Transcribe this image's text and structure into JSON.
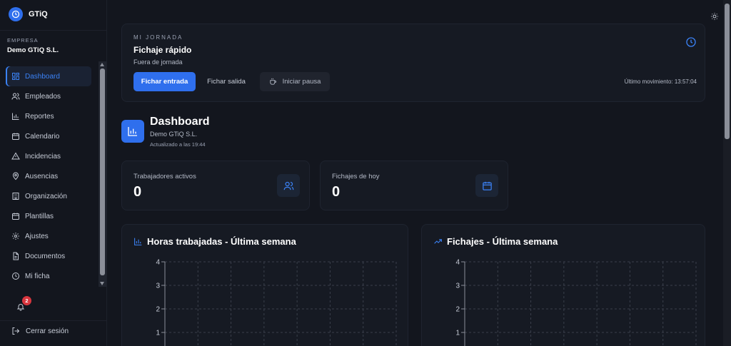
{
  "app": {
    "name": "GTiQ"
  },
  "company": {
    "label": "EMPRESA",
    "name": "Demo GTiQ S.L."
  },
  "nav": [
    {
      "label": "Dashboard",
      "icon": "dashboard-icon",
      "active": true
    },
    {
      "label": "Empleados",
      "icon": "users-icon"
    },
    {
      "label": "Reportes",
      "icon": "bar-chart-icon"
    },
    {
      "label": "Calendario",
      "icon": "calendar-icon"
    },
    {
      "label": "Incidencias",
      "icon": "warning-icon"
    },
    {
      "label": "Ausencias",
      "icon": "map-pin-icon"
    },
    {
      "label": "Organización",
      "icon": "building-icon"
    },
    {
      "label": "Plantillas",
      "icon": "calendar-template-icon"
    },
    {
      "label": "Ajustes",
      "icon": "gear-icon"
    },
    {
      "label": "Documentos",
      "icon": "document-icon"
    },
    {
      "label": "Mi ficha",
      "icon": "clock-icon"
    }
  ],
  "notifications": {
    "count": "2"
  },
  "logout": {
    "label": "Cerrar sesión"
  },
  "jornada": {
    "kicker": "MI JORNADA",
    "title": "Fichaje rápido",
    "status": "Fuera de jornada",
    "btn_in": "Fichar entrada",
    "btn_out": "Fichar salida",
    "btn_pause": "Iniciar pausa",
    "last_move": "Último movimiento: 13:57:04"
  },
  "dashboard": {
    "title": "Dashboard",
    "company": "Demo GTiQ S.L.",
    "updated": "Actualizado a las 19:44"
  },
  "stats": [
    {
      "label": "Trabajadores activos",
      "value": "0",
      "icon": "users-icon"
    },
    {
      "label": "Fichajes de hoy",
      "value": "0",
      "icon": "calendar-icon"
    }
  ],
  "charts": [
    {
      "title": "Horas trabajadas - Última semana",
      "icon": "bar-chart-icon"
    },
    {
      "title": "Fichajes - Última semana",
      "icon": "trending-up-icon"
    }
  ],
  "chart_data": [
    {
      "type": "bar",
      "title": "Horas trabajadas - Última semana",
      "yticks": [
        4,
        3,
        2,
        1
      ],
      "ylim": [
        0,
        4
      ],
      "grid": true,
      "series": []
    },
    {
      "type": "line",
      "title": "Fichajes - Última semana",
      "yticks": [
        4,
        3,
        2,
        1
      ],
      "ylim": [
        0,
        4
      ],
      "grid": true,
      "series": []
    }
  ],
  "colors": {
    "accent": "#2f6fed",
    "background": "#13161e",
    "card": "#161a23",
    "badge": "#d9363e"
  }
}
